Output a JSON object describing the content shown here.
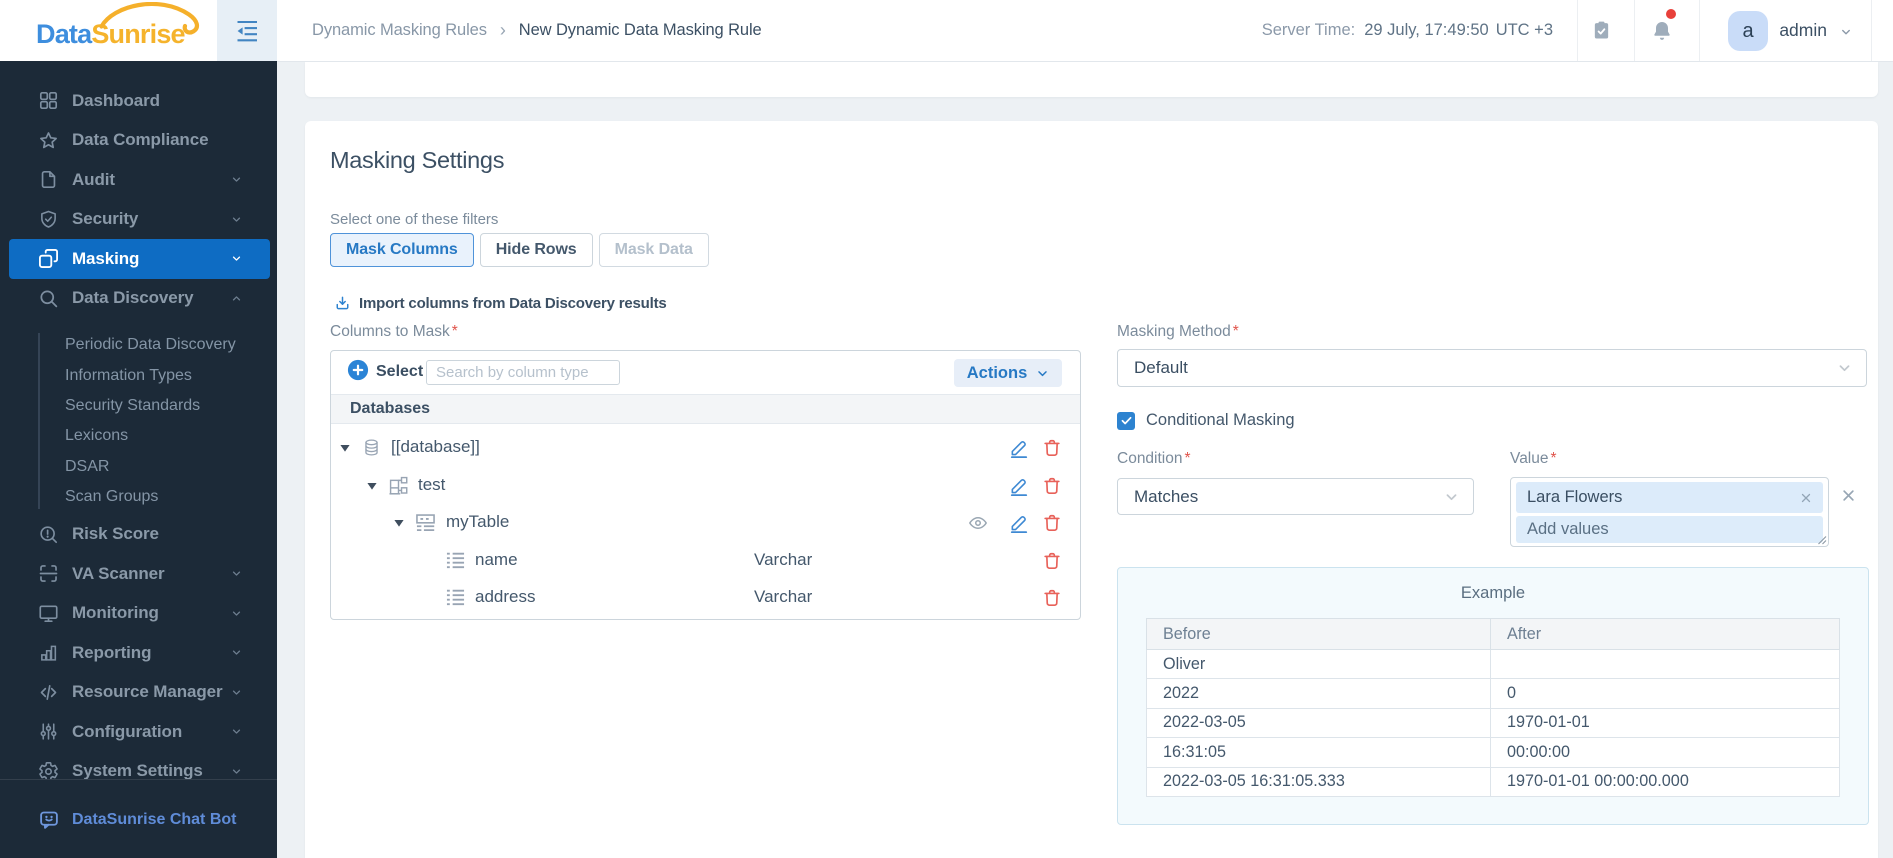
{
  "logo": {
    "part1": "Data",
    "part2": "Sunrise"
  },
  "sidebar": {
    "items": [
      {
        "label": "Dashboard"
      },
      {
        "label": "Data Compliance"
      },
      {
        "label": "Audit",
        "chevron": "down"
      },
      {
        "label": "Security",
        "chevron": "down"
      },
      {
        "label": "Masking",
        "chevron": "down",
        "active": true
      },
      {
        "label": "Data Discovery",
        "chevron": "up",
        "expanded": true
      },
      {
        "label": "Risk Score"
      },
      {
        "label": "VA Scanner",
        "chevron": "down"
      },
      {
        "label": "Monitoring",
        "chevron": "down"
      },
      {
        "label": "Reporting",
        "chevron": "down"
      },
      {
        "label": "Resource Manager",
        "chevron": "down"
      },
      {
        "label": "Configuration",
        "chevron": "down"
      },
      {
        "label": "System Settings",
        "chevron": "down"
      }
    ],
    "data_discovery_children": [
      "Periodic Data Discovery",
      "Information Types",
      "Security Standards",
      "Lexicons",
      "DSAR",
      "Scan Groups"
    ],
    "chatbot_label": "DataSunrise Chat Bot"
  },
  "header": {
    "breadcrumb_root": "Dynamic Masking Rules",
    "breadcrumb_sep": "›",
    "breadcrumb_current": "New Dynamic Data Masking Rule",
    "server_time_label": "Server Time:",
    "server_time_value": "29 July, 17:49:50",
    "server_time_tz": "UTC +3",
    "user_initial": "a",
    "user_name": "admin"
  },
  "main": {
    "title": "Masking Settings",
    "filters_label": "Select one of these filters",
    "filters": [
      {
        "label": "Mask Columns",
        "state": "active"
      },
      {
        "label": "Hide Rows",
        "state": "default"
      },
      {
        "label": "Mask Data",
        "state": "disabled"
      }
    ],
    "import_link": "Import columns from Data Discovery results",
    "required_marker": "*",
    "columns_to_mask_label": "Columns to Mask",
    "toolbar": {
      "select_label": "Select",
      "search_placeholder": "Search by column type",
      "actions_label": "Actions"
    },
    "tree_header": "Databases",
    "tree": [
      {
        "name": "[[database]]",
        "type": "database"
      },
      {
        "name": "test",
        "type": "schema"
      },
      {
        "name": "myTable",
        "type": "table"
      },
      {
        "name": "name",
        "datatype": "Varchar",
        "type": "column"
      },
      {
        "name": "address",
        "datatype": "Varchar",
        "type": "column"
      }
    ],
    "masking_method_label": "Masking Method",
    "masking_method_value": "Default",
    "conditional_masking_label": "Conditional Masking",
    "conditional_masking_checked": true,
    "condition_label": "Condition",
    "condition_value": "Matches",
    "value_label": "Value",
    "value_tag": "Lara Flowers",
    "value_placeholder": "Add values",
    "example": {
      "title": "Example",
      "columns": [
        "Before",
        "After"
      ],
      "rows": [
        [
          "Oliver",
          ""
        ],
        [
          "2022",
          "0"
        ],
        [
          "2022-03-05",
          "1970-01-01"
        ],
        [
          "16:31:05",
          "00:00:00"
        ],
        [
          "2022-03-05 16:31:05.333",
          "1970-01-01 00:00:00.000"
        ]
      ]
    }
  },
  "colors": {
    "accent_blue": "#2779c4",
    "selected_nav": "#0e6cc3",
    "sidebar_bg": "#1c2a38",
    "danger_red": "#e8625a",
    "notification_red": "#e8403a",
    "logo_blue": "#3e8ede",
    "logo_yellow": "#f5b32c"
  }
}
